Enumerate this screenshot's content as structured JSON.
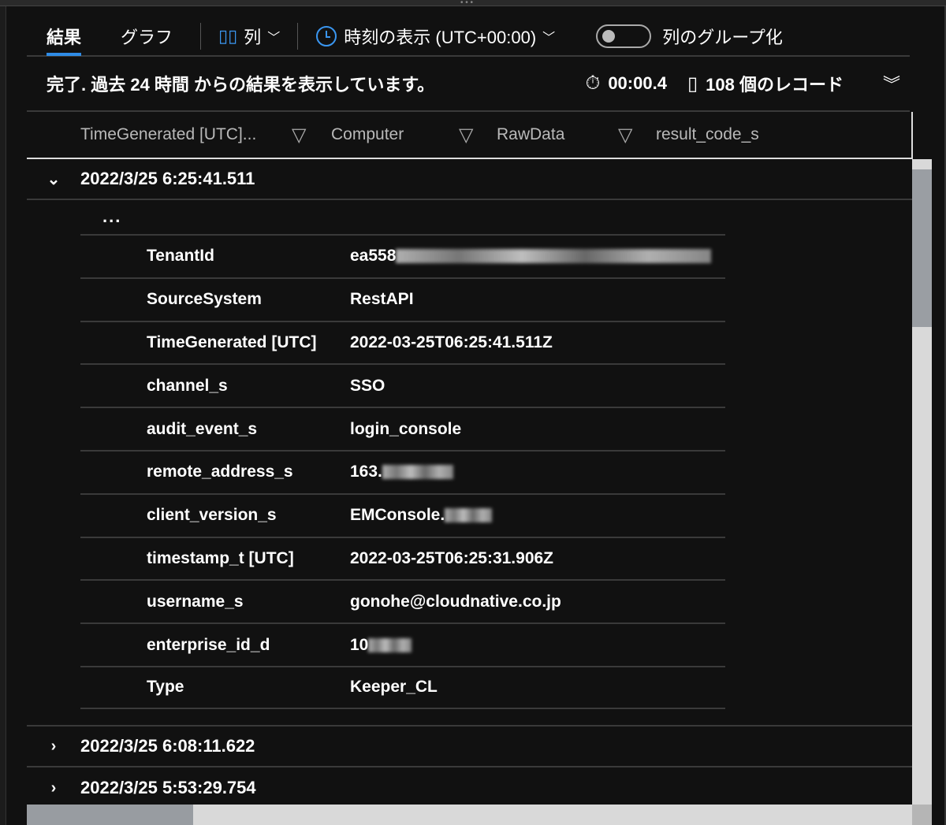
{
  "tabs": {
    "results": "結果",
    "chart": "グラフ"
  },
  "toolbar": {
    "columns": "列",
    "time_display": "時刻の表示 (UTC+00:00)",
    "group_columns": "列のグループ化"
  },
  "status": {
    "message": "完了. 過去 24 時間 からの結果を表示しています。",
    "duration": "00:00.4",
    "records": "108 個のレコード"
  },
  "columns": [
    "TimeGenerated [UTC]...",
    "Computer",
    "RawData",
    "result_code_s"
  ],
  "rows": [
    {
      "time": "2022/3/25 6:25:41.511",
      "expanded": true
    },
    {
      "time": "2022/3/25 6:08:11.622",
      "expanded": false
    },
    {
      "time": "2022/3/25 5:53:29.754",
      "expanded": false
    }
  ],
  "more": "...",
  "details": [
    {
      "key": "TenantId",
      "value": "ea558",
      "blurred": true
    },
    {
      "key": "SourceSystem",
      "value": "RestAPI"
    },
    {
      "key": "TimeGenerated [UTC]",
      "value": "2022-03-25T06:25:41.511Z"
    },
    {
      "key": "channel_s",
      "value": "SSO"
    },
    {
      "key": "audit_event_s",
      "value": "login_console"
    },
    {
      "key": "remote_address_s",
      "value": "163.",
      "blurred": true
    },
    {
      "key": "client_version_s",
      "value": "EMConsole.",
      "blurred": true
    },
    {
      "key": "timestamp_t [UTC]",
      "value": "2022-03-25T06:25:31.906Z"
    },
    {
      "key": "username_s",
      "value": "gonohe@cloudnative.co.jp"
    },
    {
      "key": "enterprise_id_d",
      "value": "10",
      "blurred": true
    },
    {
      "key": "Type",
      "value": "Keeper_CL"
    }
  ],
  "colors": {
    "accent": "#2f8ce6",
    "background": "#111111"
  }
}
